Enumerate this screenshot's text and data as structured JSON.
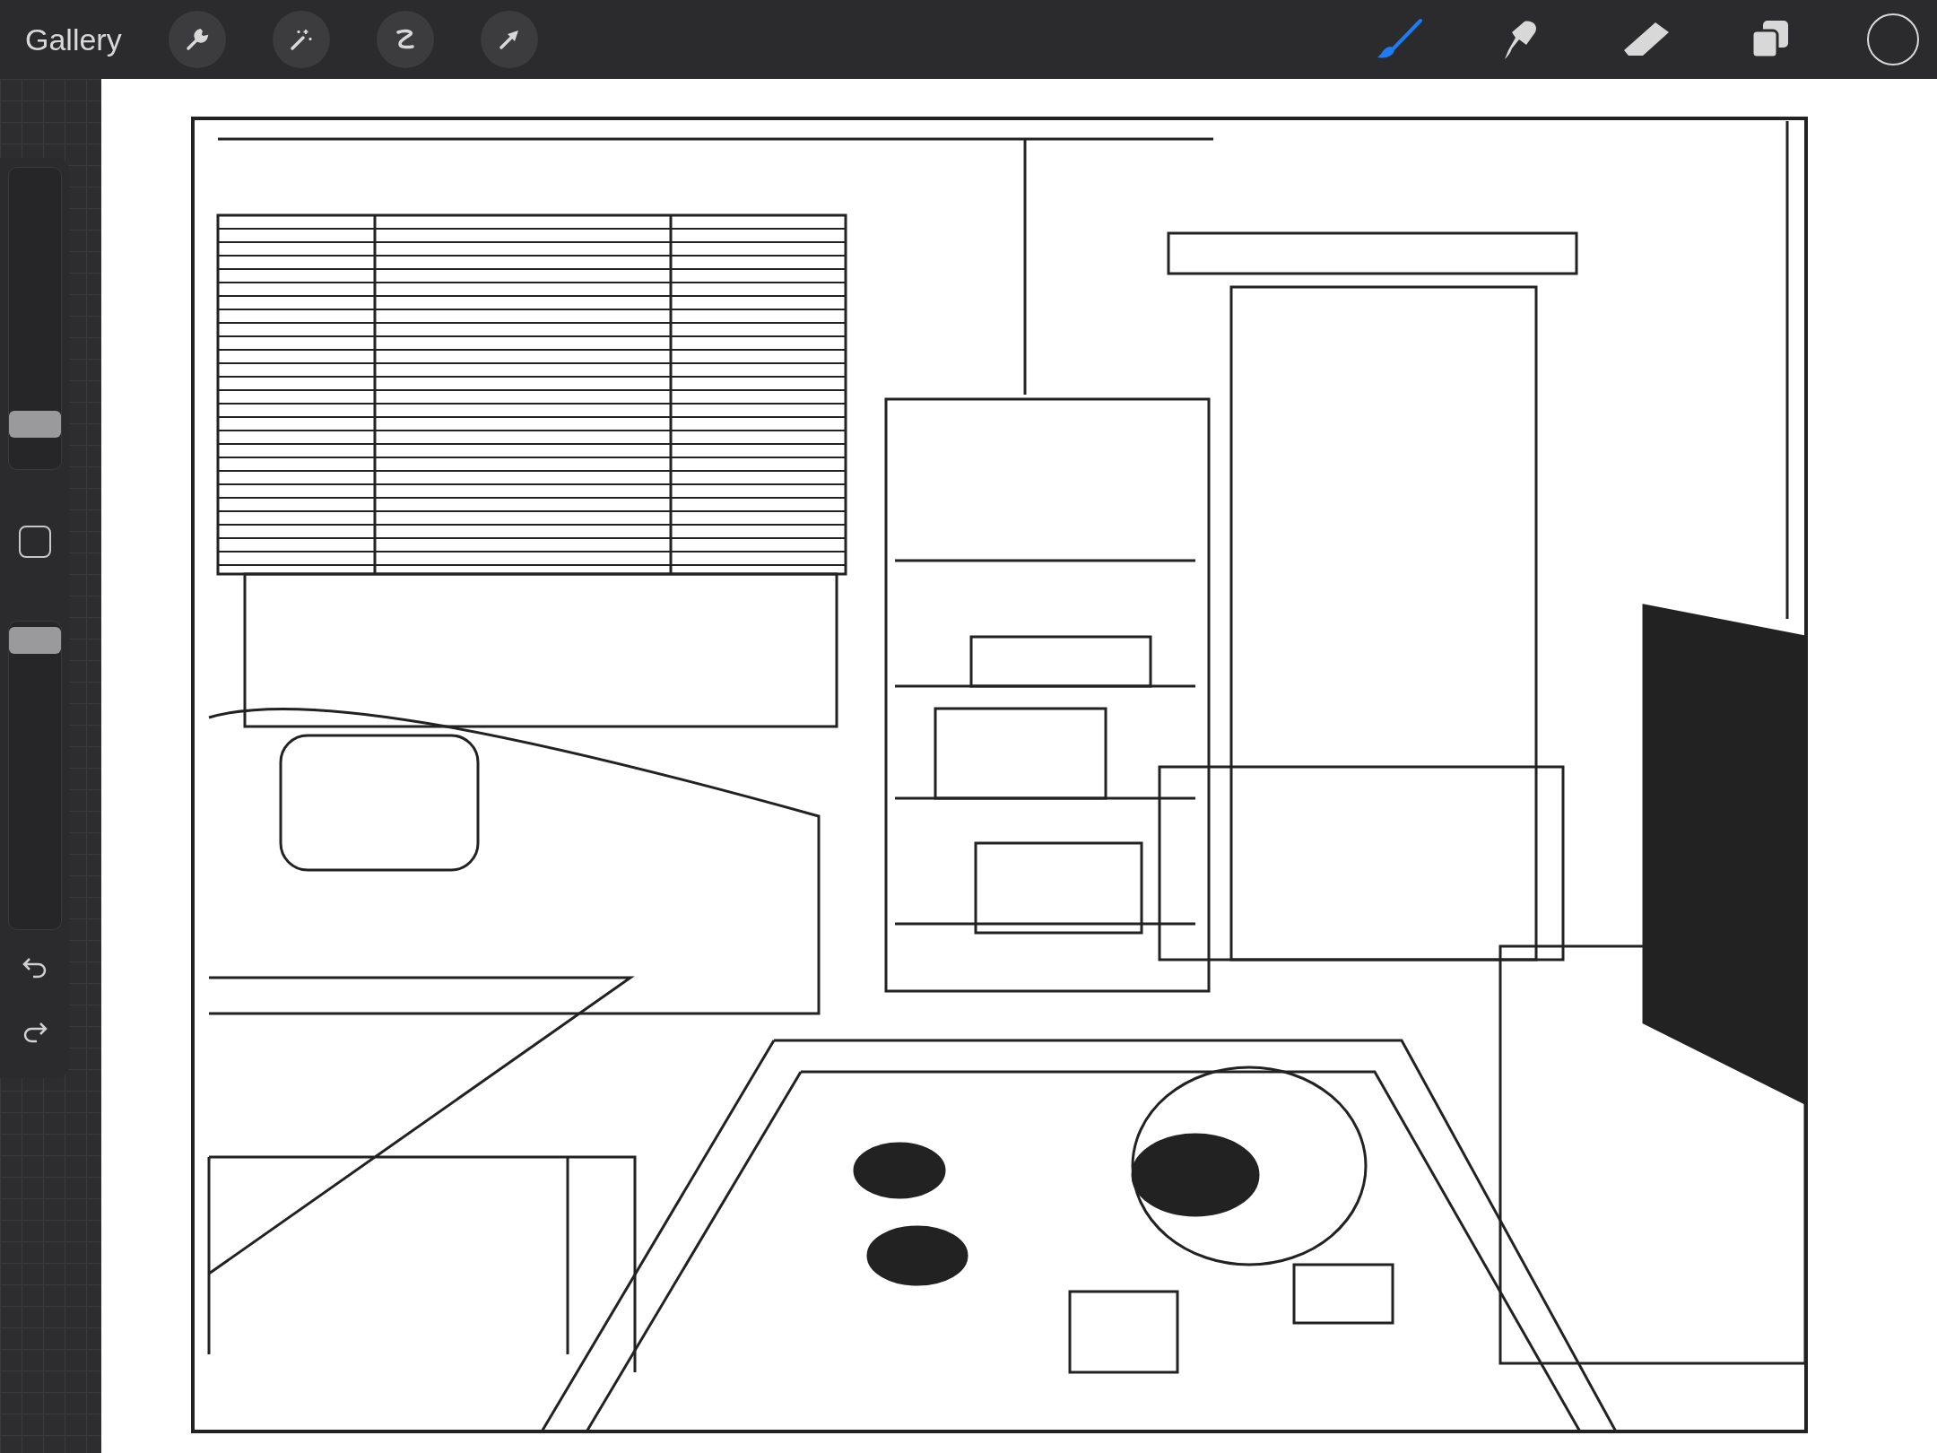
{
  "top_bar": {
    "gallery": "Gallery",
    "tools": [
      {
        "kind": "wrench",
        "selected": false
      },
      {
        "kind": "wand",
        "selected": false
      },
      {
        "kind": "selection",
        "selected": false
      },
      {
        "kind": "transform",
        "selected": false
      }
    ],
    "paint_tools": [
      {
        "kind": "brush",
        "selected": true
      },
      {
        "kind": "smudge",
        "selected": false
      },
      {
        "kind": "eraser",
        "selected": false
      },
      {
        "kind": "layers",
        "selected": false
      }
    ],
    "color": "#2b2b2d"
  },
  "sidebar": {
    "size_slider": {
      "level": 0.15
    },
    "opacity_slider": {
      "level": 0.94
    }
  }
}
